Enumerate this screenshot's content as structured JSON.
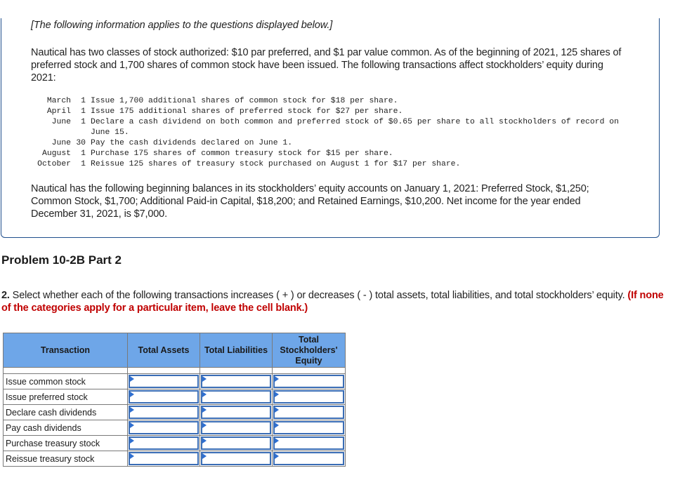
{
  "info": {
    "intro_note": "[The following information applies to the questions displayed below.]",
    "paragraph1": "Nautical has two classes of stock authorized: $10 par preferred, and $1 par value common. As of the beginning of 2021, 125 shares of preferred stock and 1,700 shares of common stock have been issued. The following transactions affect stockholders’ equity during 2021:",
    "transactions": [
      {
        "month": "March",
        "day": "1",
        "description": "Issue 1,700 additional shares of common stock for $18 per share."
      },
      {
        "month": "April",
        "day": "1",
        "description": "Issue 175 additional shares of preferred stock for $27 per share."
      },
      {
        "month": "June",
        "day": "1",
        "description": "Declare a cash dividend on both common and preferred stock of $0.65 per share to all stockholders of record on June 15."
      },
      {
        "month": "June",
        "day": "30",
        "description": "Pay the cash dividends declared on June 1."
      },
      {
        "month": "August",
        "day": "1",
        "description": "Purchase 175 shares of common treasury stock for $15 per share."
      },
      {
        "month": "October",
        "day": "1",
        "description": "Reissue 125 shares of treasury stock purchased on August 1 for $17 per share."
      }
    ],
    "paragraph2": "Nautical has the following beginning balances in its stockholders’ equity accounts on January 1, 2021: Preferred Stock, $1,250; Common Stock, $1,700; Additional Paid-in Capital, $18,200; and Retained Earnings, $10,200. Net income for the year ended December 31, 2021, is $7,000."
  },
  "problem": {
    "title": "Problem 10-2B Part 2",
    "question_number": "2.",
    "question_text": " Select whether each of the following transactions increases ( + ) or decreases ( - ) total assets, total liabilities, and total stockholders’ equity.",
    "instruction": "(If none of the categories apply for a particular item, leave the cell blank.)"
  },
  "table": {
    "headers": {
      "transaction": "Transaction",
      "total_assets": "Total Assets",
      "total_liabilities": "Total Liabilities",
      "total_equity_line1": "Total",
      "total_equity_line2": "Stockholders'",
      "total_equity_line3": "Equity"
    },
    "rows": [
      {
        "transaction": "Issue common stock",
        "total_assets": "",
        "total_liabilities": "",
        "total_equity": ""
      },
      {
        "transaction": "Issue preferred stock",
        "total_assets": "",
        "total_liabilities": "",
        "total_equity": ""
      },
      {
        "transaction": "Declare cash dividends",
        "total_assets": "",
        "total_liabilities": "",
        "total_equity": ""
      },
      {
        "transaction": "Pay cash dividends",
        "total_assets": "",
        "total_liabilities": "",
        "total_equity": ""
      },
      {
        "transaction": "Purchase treasury stock",
        "total_assets": "",
        "total_liabilities": "",
        "total_equity": ""
      },
      {
        "transaction": "Reissue treasury stock",
        "total_assets": "",
        "total_liabilities": "",
        "total_equity": ""
      }
    ]
  },
  "colors": {
    "header_bg": "#6ea6e8",
    "input_border": "#3a6db5",
    "instruction_red": "#c00000",
    "card_border": "#1f4e8c"
  }
}
